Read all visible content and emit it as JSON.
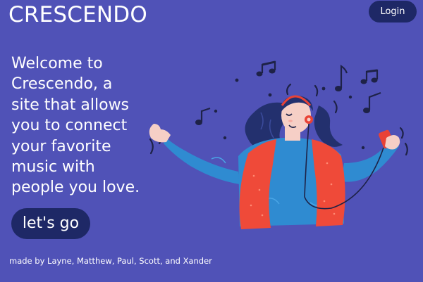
{
  "header": {
    "brand": "CRESCENDO",
    "login_label": "Login"
  },
  "hero": {
    "welcome_text": "Welcome to Crescendo, a site that allows you to connect your favorite music with people you love.",
    "cta_label": "let's go",
    "illustration_icon": "woman-listening-music-illustration"
  },
  "footer": {
    "credits": "made by Layne, Matthew, Paul, Scott, and Xander"
  },
  "colors": {
    "background": "#5052b7",
    "button_bg": "#1e2866",
    "text": "#ffffff",
    "shirt": "#2f8bd1",
    "vest": "#ef4a39",
    "hair": "#23306e"
  }
}
